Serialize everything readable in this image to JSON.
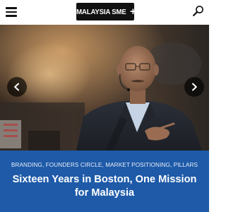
{
  "header": {
    "logo_text": "MALAYSIA SME",
    "logo_plus": "+",
    "menu_icon": "hamburger-menu-icon",
    "search_icon": "search-icon"
  },
  "hero": {
    "prev_icon": "chevron-left-icon",
    "next_icon": "chevron-right-icon"
  },
  "article": {
    "categories": [
      "BRANDING",
      "FOUNDERS CIRCLE",
      "MARKET POSITIONING",
      "PILLARS"
    ],
    "category_separator": ", ",
    "headline": "Sixteen Years in Boston, One Mission for Malaysia"
  },
  "colors": {
    "caption_background": "#1e5aa8",
    "logo_background": "#111111"
  }
}
